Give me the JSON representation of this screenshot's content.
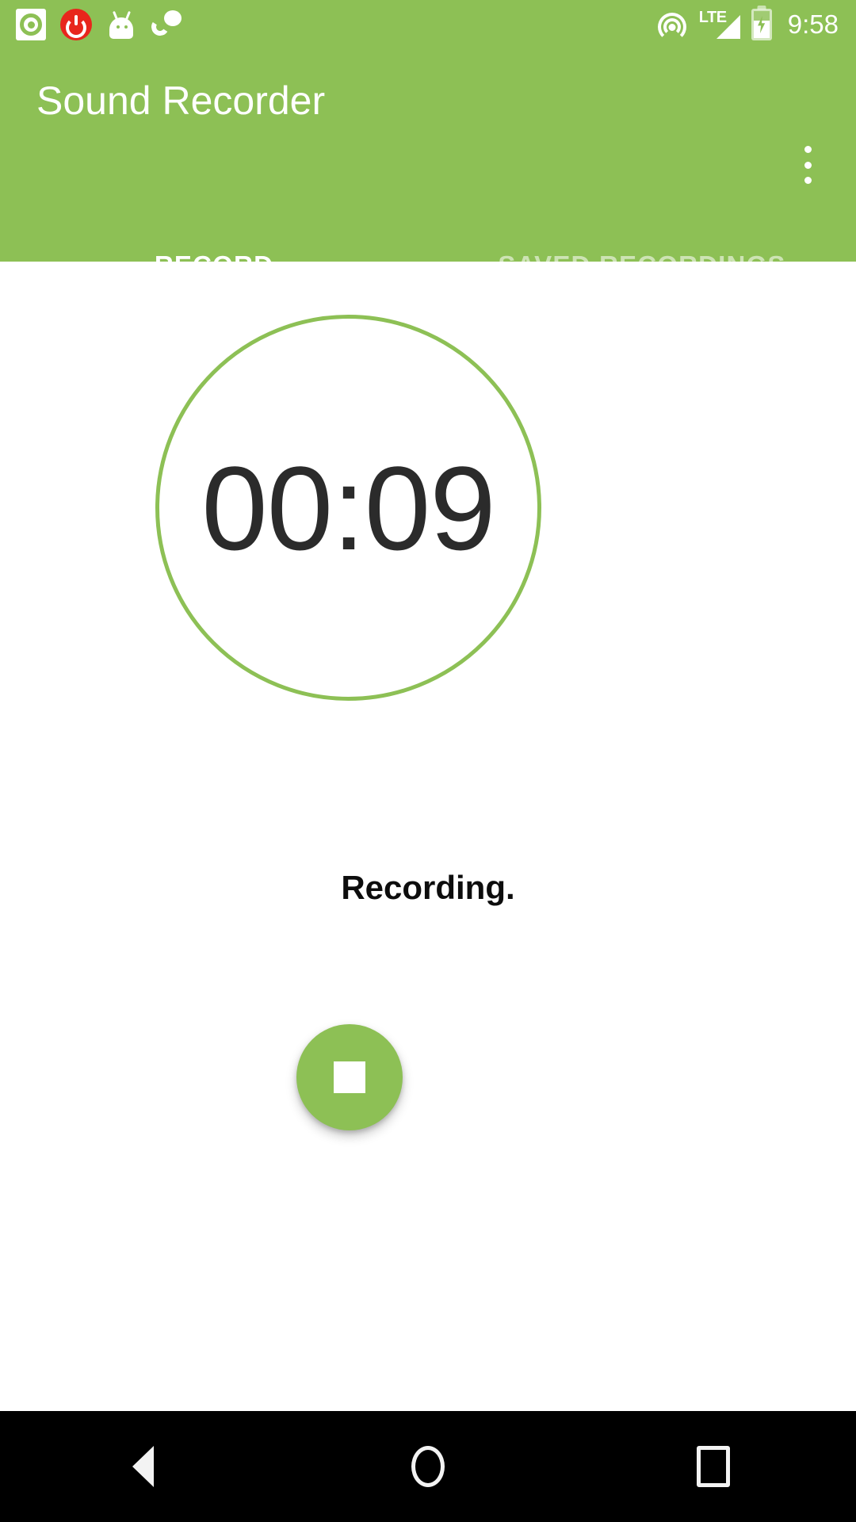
{
  "status_bar": {
    "icons_left": [
      {
        "name": "recording-notification-icon",
        "label": "recording"
      },
      {
        "name": "power-icon",
        "label": "power"
      },
      {
        "name": "android-icon",
        "label": "android"
      },
      {
        "name": "call-icon",
        "label": "call"
      }
    ],
    "icons_right": [
      {
        "name": "hotspot-icon",
        "label": "hotspot"
      },
      {
        "name": "signal-icon",
        "label": "LTE"
      },
      {
        "name": "battery-charging-icon",
        "label": "battery charging"
      }
    ],
    "network_type": "LTE",
    "time": "9:58"
  },
  "app_bar": {
    "title": "Sound Recorder",
    "overflow_menu_label": "More options"
  },
  "tabs": {
    "items": [
      {
        "label": "RECORD",
        "active": true
      },
      {
        "label": "SAVED RECORDINGS",
        "active": false
      }
    ]
  },
  "record_screen": {
    "timer": "00:09",
    "status_text": "Recording.",
    "stop_button_label": "Stop recording"
  },
  "nav_bar": {
    "back_label": "Back",
    "home_label": "Home",
    "recents_label": "Recent apps"
  },
  "colors": {
    "accent_green": "#8dc055",
    "status_bar_green": "#8dc055",
    "timer_text": "#2b2b2b",
    "power_red": "#e8261c",
    "nav_bar_bg": "#000000"
  }
}
